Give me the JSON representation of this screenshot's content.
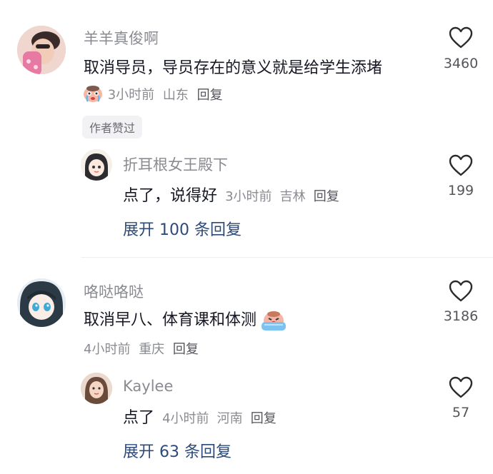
{
  "comments": [
    {
      "username": "羊羊真俊啊",
      "text": "取消导员，导员存在的意义就是给学生添堵",
      "time": "3小时前",
      "location": "山东",
      "reply_label": "回复",
      "likes": "3460",
      "badge": "作者赞过",
      "reply": {
        "username": "折耳根女王殿下",
        "text": "点了，说得好",
        "time": "3小时前",
        "location": "吉林",
        "reply_label": "回复",
        "likes": "199"
      },
      "expand_label": "展开 100 条回复"
    },
    {
      "username": "咯哒咯哒",
      "text": "取消早八、体育课和体测",
      "time": "4小时前",
      "location": "重庆",
      "reply_label": "回复",
      "likes": "3186",
      "reply": {
        "username": "Kaylee",
        "text": "点了",
        "time": "4小时前",
        "location": "河南",
        "reply_label": "回复",
        "likes": "57"
      },
      "expand_label": "展开 63 条回复"
    }
  ],
  "icons": {
    "like": "heart-outline-icon",
    "emoji_1": "crying-face-emoji",
    "emoji_2": "tearful-face-emoji"
  },
  "colors": {
    "username": "#8a8b91",
    "content": "#161823",
    "expand_link": "#2c4a7a",
    "badge_bg": "#f2f2f4"
  }
}
